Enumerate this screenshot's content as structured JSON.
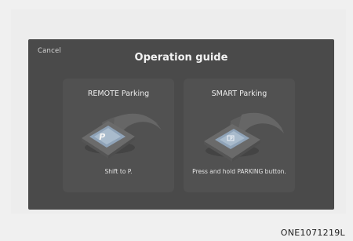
{
  "screen": {
    "cancel_label": "Cancel",
    "title": "Operation guide"
  },
  "cards": [
    {
      "title": "REMOTE Parking",
      "description": "Shift to P.",
      "icon": "key-fob-p-button-icon"
    },
    {
      "title": "SMART Parking",
      "description": "Press and hold PARKING button.",
      "icon": "console-parking-button-icon"
    }
  ],
  "caption": "ONE1071219L",
  "colors": {
    "screen_bg": "#4a4a4a",
    "card_bg": "#515151",
    "page_bg": "#f0f0f0"
  }
}
